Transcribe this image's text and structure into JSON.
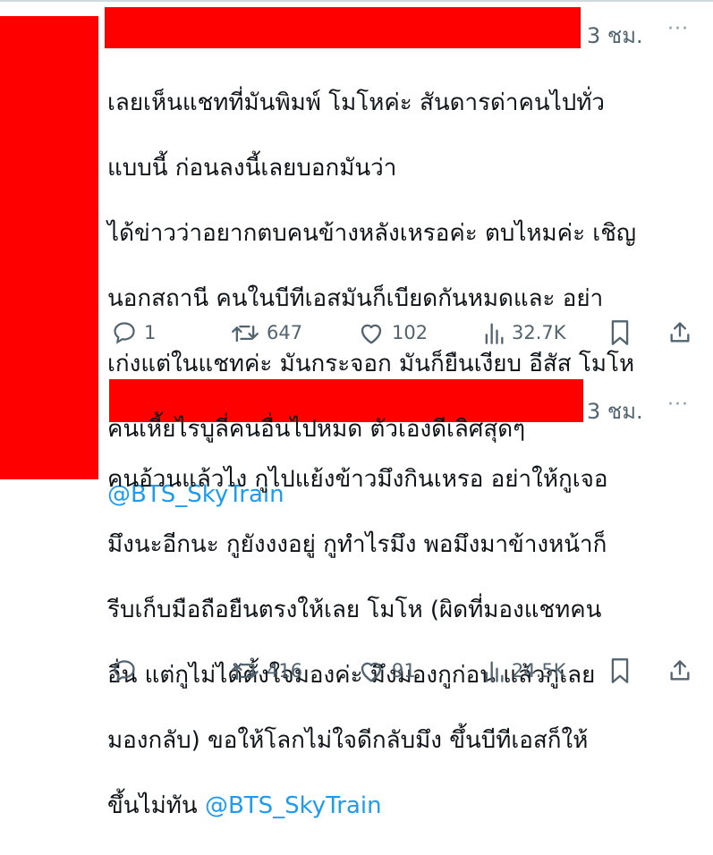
{
  "tweets": [
    {
      "time": "3 ชม.",
      "more": "···",
      "lines": [
        "เลยเห็นแชทที่มันพิมพ์ โมโหค่ะ สันดารด่าคนไปทั่ว",
        "แบบนี้  ก่อนลงนี้เลยบอกมันว่า",
        "ได้ข่าวว่าอยากตบคนข้างหลังเหรอค่ะ ตบไหมค่ะ เชิญ",
        "นอกสถานี คนในบีทีเอสมันก็เบียดกันหมดและ อย่า",
        "เก่งแต่ในแชทค่ะ มันกระจอก มันก็ยืนเงียบ อีสัส  โมโห",
        "คนเหี้ยไรบูลี่คนอื่นไปหมด ตัวเองดีเลิศสุดๆ"
      ],
      "mention": "@BTS_SkyTrain",
      "replies": "1",
      "retweets": "647",
      "likes": "102",
      "views": "32.7K"
    },
    {
      "time": "3 ชม.",
      "more": "···",
      "lines": [
        "คนอ้วนแล้วไง กูไปแย้งข้าวมึงกินเหรอ อย่าให้กูเจอ",
        "มึงนะอีกนะ กูยังงงอยู่ กูทำไรมึง พอมึงมาข้างหน้าก็",
        "รีบเก็บมือถือยืนตรงให้เลย  โมโห (ผิดที่มองแชทคน",
        "อื่น แต่กูไม่ได้ตั้งใจมองค่ะ มึงมองกูก่อน แล้วกูเลย",
        "มองกลับ) ขอให้โลกไม่ใจดีกลับมึง ขึ้นบีทีเอสก็ให้"
      ],
      "last_line_prefix": "ขึ้นไม่ทัน ",
      "mention": "@BTS_SkyTrain",
      "retweets": "416",
      "likes": "91",
      "views": "24.5K"
    }
  ],
  "colors": {
    "redaction": "#ff0000",
    "mention": "#1d9bf0",
    "secondary": "#536471"
  },
  "icons": [
    "reply-icon",
    "retweet-icon",
    "like-icon",
    "views-icon",
    "bookmark-icon",
    "share-icon"
  ]
}
